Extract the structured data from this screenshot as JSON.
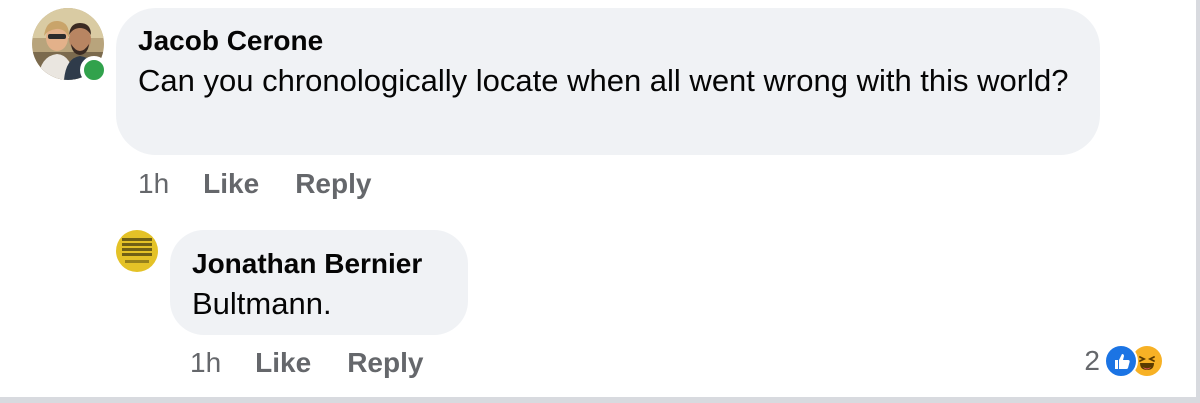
{
  "comment": {
    "author": "Jacob Cerone",
    "text": "Can you chronologically locate when all went wrong with this world?",
    "time": "1h",
    "like_label": "Like",
    "reply_label": "Reply"
  },
  "reply": {
    "author": "Jonathan Bernier",
    "text": "Bultmann.",
    "time": "1h",
    "like_label": "Like",
    "reply_label": "Reply",
    "avatar_text": "RECONSIDERING THE DATES OF THE NEW TESTAMENT",
    "reactions": {
      "count": "2",
      "icons": [
        "like-icon",
        "haha-icon"
      ]
    }
  },
  "colors": {
    "bubble": "#f0f2f5",
    "meta_text": "#65676b",
    "online": "#31a24c",
    "like_blue": "#1b74e4",
    "haha_yellow": "#f7b125"
  }
}
